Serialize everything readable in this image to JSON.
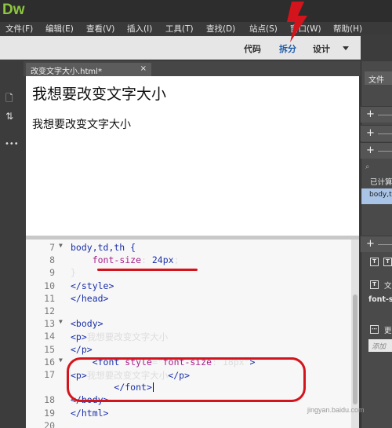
{
  "app": {
    "logo": "Dw"
  },
  "menu": [
    "文件(F)",
    "编辑(E)",
    "查看(V)",
    "插入(I)",
    "工具(T)",
    "查找(D)",
    "站点(S)",
    "窗口(W)",
    "帮助(H)"
  ],
  "view_modes": {
    "code": "代码",
    "split": "拆分",
    "design": "设计",
    "active": "拆分"
  },
  "document_tab": {
    "filename": "改变文字大小.html*",
    "close": "×"
  },
  "design_view": {
    "heading_large": "我想要改变文字大小",
    "heading_small": "我想要改变文字大小"
  },
  "code_view": {
    "lines": [
      {
        "num": "7",
        "fold": "▼",
        "html": "body,td,th {"
      },
      {
        "num": "8",
        "fold": "",
        "html": "    font-size: 24px;"
      },
      {
        "num": "9",
        "fold": "",
        "html": "}"
      },
      {
        "num": "10",
        "fold": "",
        "html": "</style>"
      },
      {
        "num": "11",
        "fold": "",
        "html": "</head>"
      },
      {
        "num": "12",
        "fold": "",
        "html": ""
      },
      {
        "num": "13",
        "fold": "▼",
        "html": "<body>"
      },
      {
        "num": "14",
        "fold": "",
        "html": "<p>我想要改变文字大小"
      },
      {
        "num": "15",
        "fold": "",
        "html": "</p>"
      },
      {
        "num": "16",
        "fold": "▼",
        "html": "    <font style=\"font-size: 18px\">"
      },
      {
        "num": "17",
        "fold": "",
        "html": "<p>我想要改变文字大小</p>"
      },
      {
        "num": "",
        "fold": "",
        "html": "        </font>"
      },
      {
        "num": "18",
        "fold": "",
        "html": "</body>"
      },
      {
        "num": "19",
        "fold": "",
        "html": "</html>"
      },
      {
        "num": "20",
        "fold": "",
        "html": ""
      }
    ]
  },
  "right_panel": {
    "tab_files": "文件",
    "computed_label": "已计算",
    "highlight_item": "body,t",
    "label_wen": "文",
    "label_font": "font-s",
    "label_more": "更",
    "input_placeholder": "添加"
  },
  "left_toolbar": {
    "more": "•••"
  },
  "watermark": "jingyan.baidu.com",
  "colors": {
    "accent_blue": "#1f5ca8",
    "annotation_red": "#d4141c",
    "logo_green": "#8cc63f"
  }
}
